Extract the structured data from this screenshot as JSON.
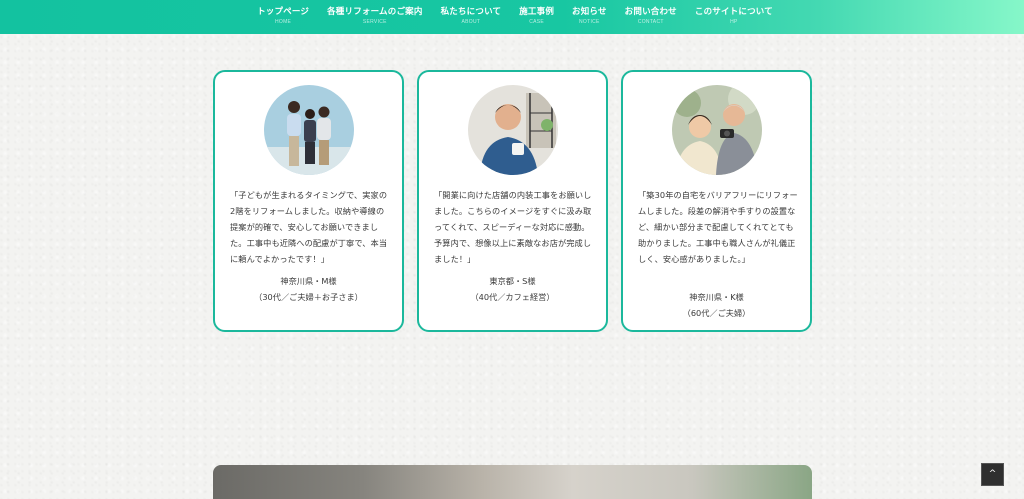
{
  "nav": {
    "items": [
      {
        "ja": "トップページ",
        "en": "HOME"
      },
      {
        "ja": "各種リフォームのご案内",
        "en": "SERVICE"
      },
      {
        "ja": "私たちについて",
        "en": "ABOUT"
      },
      {
        "ja": "施工事例",
        "en": "CASE"
      },
      {
        "ja": "お知らせ",
        "en": "NOTICE"
      },
      {
        "ja": "お問い合わせ",
        "en": "CONTACT"
      },
      {
        "ja": "このサイトについて",
        "en": "HP"
      }
    ]
  },
  "testimonials": [
    {
      "quote": "「子どもが生まれるタイミングで、実家の2階をリフォームしました。収納や導線の提案が的確で、安心してお願いできました。工事中も近隣への配慮が丁寧で、本当に頼んでよかったです！」",
      "name": "神奈川県・M様",
      "detail": "（30代／ご夫婦＋お子さま）",
      "photo": "family-photo"
    },
    {
      "quote": "「開業に向けた店舗の内装工事をお願いしました。こちらのイメージをすぐに汲み取ってくれて、スピーディーな対応に感動。予算内で、想像以上に素敵なお店が完成しました！」",
      "name": "東京都・S様",
      "detail": "（40代／カフェ経営）",
      "photo": "cafe-owner-photo"
    },
    {
      "quote": "「築30年の自宅をバリアフリーにリフォームしました。段差の解消や手すりの設置など、細かい部分まで配慮してくれてとても助かりました。工事中も職人さんが礼儀正しく、安心感がありました。」",
      "name": "神奈川県・K様",
      "detail": "（60代／ご夫婦）",
      "photo": "senior-couple-photo"
    }
  ],
  "back_to_top": {
    "icon": "chevron-up-icon",
    "glyph": "^"
  },
  "colors": {
    "accent": "#1bb89c",
    "nav_start": "#13c2a0",
    "nav_end": "#86f7c9"
  }
}
